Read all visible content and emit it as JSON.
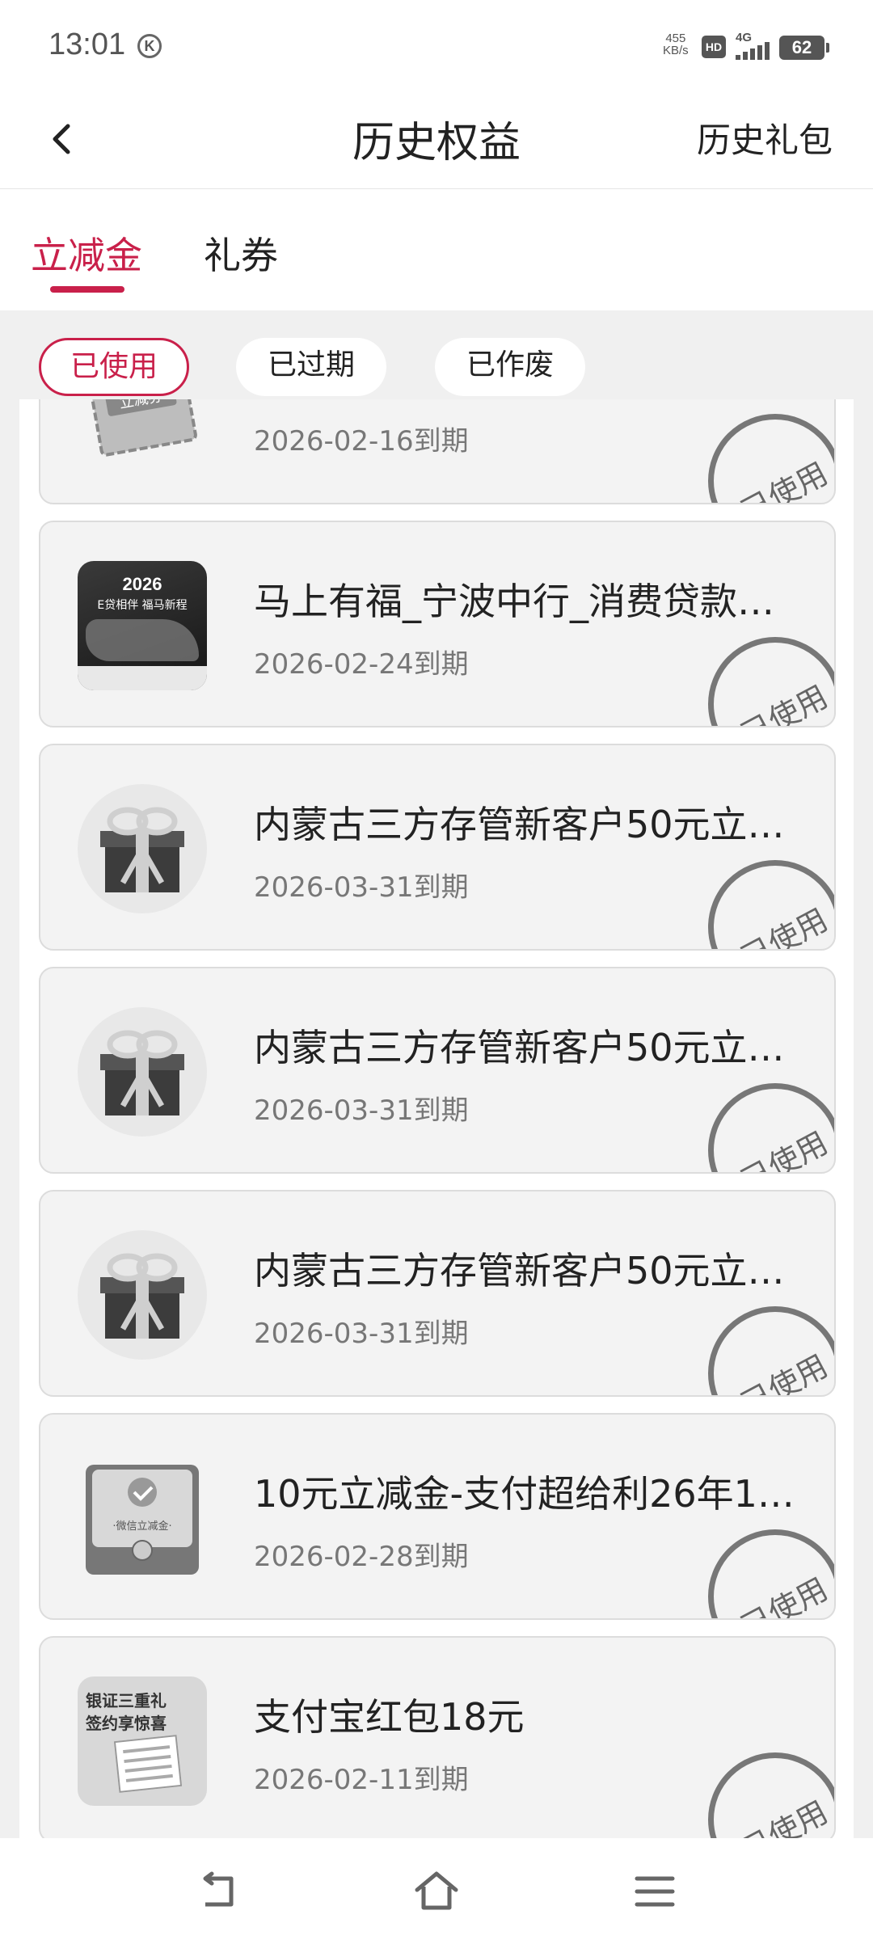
{
  "status_bar": {
    "time": "13:01",
    "k_icon": "K",
    "net_speed_value": "455",
    "net_speed_unit": "KB/s",
    "hd": "HD",
    "network": "4G",
    "battery": "62"
  },
  "header": {
    "title": "历史权益",
    "right_link": "历史礼包",
    "back_icon": "chevron-left-icon"
  },
  "tabs": [
    {
      "label": "立减金",
      "active": true
    },
    {
      "label": "礼券",
      "active": false
    }
  ],
  "filters": [
    {
      "label": "已使用",
      "active": true
    },
    {
      "label": "已过期",
      "active": false
    },
    {
      "label": "已作废",
      "active": false
    }
  ],
  "accent_color": "#c9204a",
  "items": [
    {
      "title": "",
      "date": "2026-02-16到期",
      "status": "已使用",
      "thumb": "ticket",
      "thumb_text": "立减券"
    },
    {
      "title": "马上有福_宁波中行_消费贷款…",
      "date": "2026-02-24到期",
      "status": "已使用",
      "thumb": "poster",
      "thumb_text": "2026",
      "thumb_subtext": "E贷相伴 福马新程"
    },
    {
      "title": "内蒙古三方存管新客户50元立…",
      "date": "2026-03-31到期",
      "status": "已使用",
      "thumb": "gift"
    },
    {
      "title": "内蒙古三方存管新客户50元立…",
      "date": "2026-03-31到期",
      "status": "已使用",
      "thumb": "gift"
    },
    {
      "title": "内蒙古三方存管新客户50元立…",
      "date": "2026-03-31到期",
      "status": "已使用",
      "thumb": "gift"
    },
    {
      "title": "10元立减金-支付超给利26年1…",
      "date": "2026-02-28到期",
      "status": "已使用",
      "thumb": "wechat",
      "thumb_text": "·微信立减金·"
    },
    {
      "title": "支付宝红包18元",
      "date": "2026-02-11到期",
      "status": "已使用",
      "thumb": "banner",
      "thumb_text": "银证三重礼",
      "thumb_subtext": "签约享惊喜"
    }
  ],
  "bottom_nav": {
    "icons": [
      "back-nav-icon",
      "home-icon",
      "menu-icon"
    ]
  }
}
